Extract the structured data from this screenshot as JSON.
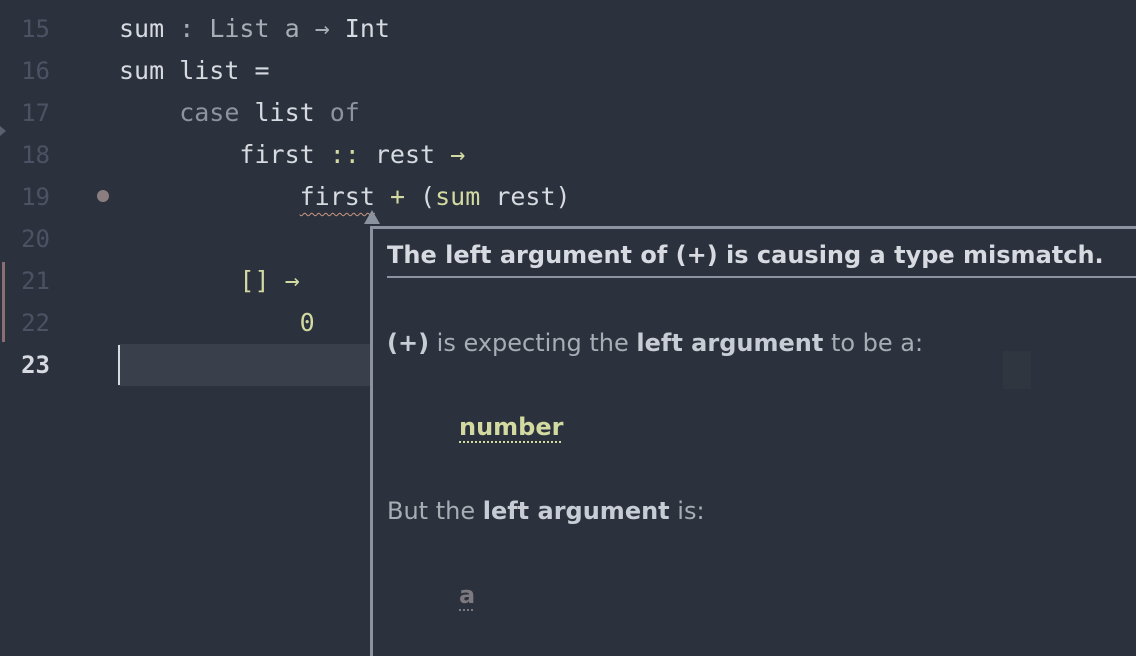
{
  "editor": {
    "lines": [
      {
        "num": "15",
        "tokens": [
          {
            "t": "sum",
            "c": "tok-plain"
          },
          {
            "t": " : ",
            "c": "tok-type"
          },
          {
            "t": "List a",
            "c": "tok-type"
          },
          {
            "t": " → ",
            "c": "tok-type"
          },
          {
            "t": "Int",
            "c": "tok-typename"
          }
        ]
      },
      {
        "num": "16",
        "tokens": [
          {
            "t": "sum list ",
            "c": "tok-plain"
          },
          {
            "t": "=",
            "c": "tok-plain"
          }
        ]
      },
      {
        "num": "17",
        "tokens": [
          {
            "t": "    case ",
            "c": "tok-kw"
          },
          {
            "t": "list",
            "c": "tok-plain"
          },
          {
            "t": " of",
            "c": "tok-kw"
          }
        ]
      },
      {
        "num": "18",
        "tokens": [
          {
            "t": "        first ",
            "c": "tok-plain"
          },
          {
            "t": "::",
            "c": "tok-op"
          },
          {
            "t": " rest ",
            "c": "tok-plain"
          },
          {
            "t": "→",
            "c": "tok-op"
          }
        ]
      },
      {
        "num": "19",
        "tokens": [
          {
            "t": "            ",
            "c": "tok-plain"
          },
          {
            "t": "first",
            "c": "tok-plain err-word"
          },
          {
            "t": " + ",
            "c": "tok-op"
          },
          {
            "t": "(",
            "c": "tok-plain"
          },
          {
            "t": "sum",
            "c": "tok-op"
          },
          {
            "t": " rest)",
            "c": "tok-plain"
          }
        ]
      },
      {
        "num": "20",
        "tokens": []
      },
      {
        "num": "21",
        "tokens": [
          {
            "t": "        [] ",
            "c": "tok-op"
          },
          {
            "t": "→",
            "c": "tok-op"
          }
        ]
      },
      {
        "num": "22",
        "tokens": [
          {
            "t": "            0",
            "c": "tok-num"
          }
        ]
      },
      {
        "num": "23",
        "tokens": [],
        "current": true
      }
    ]
  },
  "tooltip": {
    "heading": "The left argument of (+) is causing a type mismatch.",
    "expect_op": "(+)",
    "expect_mid": " is expecting the ",
    "expect_bold": "left argument",
    "expect_end": " to be a:",
    "expected_type": "number",
    "but_start": "But the ",
    "but_bold": "left argument",
    "but_end": " is:",
    "actual_type": "a"
  },
  "colors": {
    "background": "#2c323d",
    "accent_yellow": "#d2d9a1",
    "popup_border": "#8c93a0"
  }
}
